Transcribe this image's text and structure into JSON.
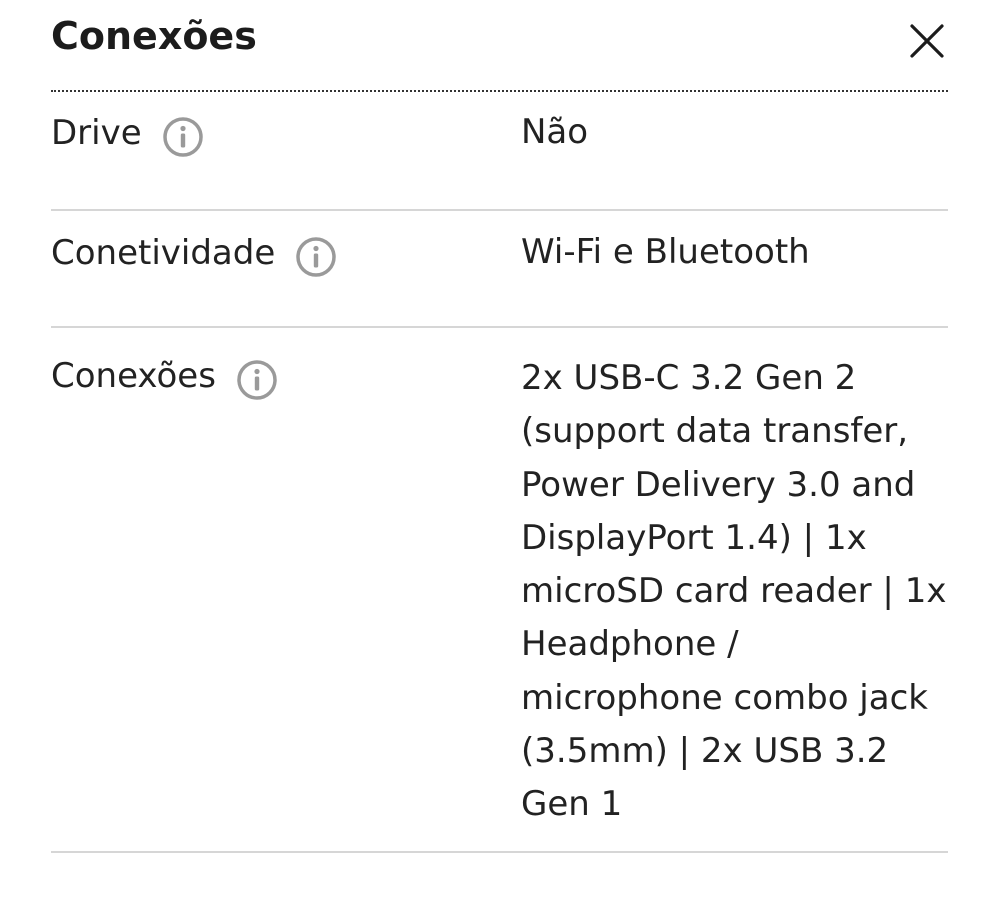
{
  "header": {
    "title": "Conexões",
    "close_icon": "close-icon"
  },
  "rows": [
    {
      "label": "Drive",
      "info_icon": "info-icon",
      "value": "Não"
    },
    {
      "label": "Conetividade",
      "info_icon": "info-icon",
      "value": "Wi-Fi e Bluetooth"
    },
    {
      "label": "Conexões",
      "info_icon": "info-icon",
      "value": "2x USB-C 3.2 Gen 2\n(support data transfer,\nPower Delivery 3.0 and\nDisplayPort 1.4) | 1x\nmicroSD card reader | 1x\nHeadphone /\nmicrophone combo jack\n(3.5mm) | 2x USB 3.2\nGen 1"
    }
  ],
  "colors": {
    "text": "#222222",
    "divider": "#d6d6d6",
    "icon_gray": "#9a9a9a"
  }
}
